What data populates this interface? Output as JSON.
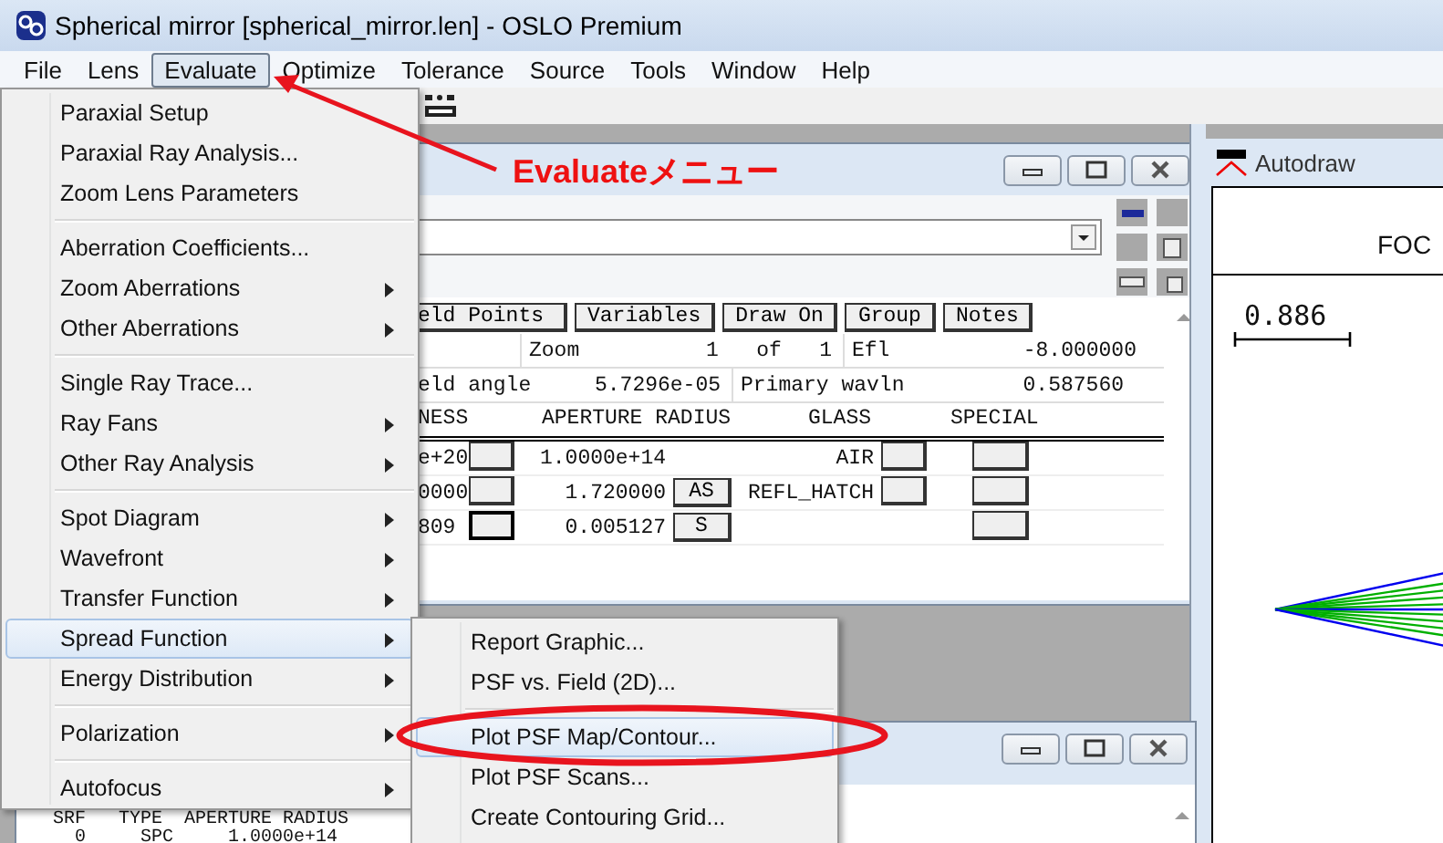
{
  "window": {
    "title": "Spherical mirror [spherical_mirror.len] - OSLO Premium"
  },
  "menu_bar": [
    {
      "label": "File",
      "selected": false
    },
    {
      "label": "Lens",
      "selected": false
    },
    {
      "label": "Evaluate",
      "selected": true
    },
    {
      "label": "Optimize",
      "selected": false
    },
    {
      "label": "Tolerance",
      "selected": false
    },
    {
      "label": "Source",
      "selected": false
    },
    {
      "label": "Tools",
      "selected": false
    },
    {
      "label": "Window",
      "selected": false
    },
    {
      "label": "Help",
      "selected": false
    }
  ],
  "lens_window": {
    "buttons": [
      "eld Points",
      "Variables",
      "Draw On",
      "Group",
      "Notes"
    ],
    "info_rows": [
      [
        {
          "label": "Zoom",
          "value": "1   of   1"
        },
        {
          "label": "Efl",
          "value": "-8.000000"
        }
      ],
      [
        {
          "label": "eld angle",
          "value": "5.7296e-05"
        },
        {
          "label": "Primary wavln",
          "value": "0.587560"
        }
      ]
    ],
    "columns": [
      "NESS",
      "APERTURE RADIUS",
      "GLASS",
      "SPECIAL"
    ],
    "rows": [
      {
        "thickness": "e+20",
        "focused": false,
        "aperture": "1.0000e+14",
        "glass": "AIR",
        "glass_button": true
      },
      {
        "thickness": "0000",
        "focused": false,
        "aperture": "1.720000",
        "solve": "AS",
        "glass": "REFL_HATCH",
        "glass_button": true
      },
      {
        "thickness": "809",
        "focused": true,
        "aperture": "0.005127",
        "solve": "S",
        "glass_button": false
      }
    ]
  },
  "autodraw": {
    "title": "Autodraw",
    "heading": "FOC",
    "scale": "0.886"
  },
  "text_window": {
    "lines": [
      "SRF   TYPE  APERTURE RADIUS",
      "  0     SPC     1.0000e+14"
    ]
  },
  "evaluate_menu": [
    {
      "kind": "item",
      "label": "Paraxial Setup",
      "submenu": false,
      "selected": false
    },
    {
      "kind": "item",
      "label": "Paraxial Ray Analysis...",
      "submenu": false,
      "selected": false
    },
    {
      "kind": "item",
      "label": "Zoom Lens Parameters",
      "submenu": false,
      "selected": false
    },
    {
      "kind": "separator"
    },
    {
      "kind": "item",
      "label": "Aberration Coefficients...",
      "submenu": false,
      "selected": false
    },
    {
      "kind": "item",
      "label": "Zoom Aberrations",
      "submenu": true,
      "selected": false
    },
    {
      "kind": "item",
      "label": "Other Aberrations",
      "submenu": true,
      "selected": false
    },
    {
      "kind": "separator"
    },
    {
      "kind": "item",
      "label": "Single Ray Trace...",
      "submenu": false,
      "selected": false
    },
    {
      "kind": "item",
      "label": "Ray Fans",
      "submenu": true,
      "selected": false
    },
    {
      "kind": "item",
      "label": "Other Ray Analysis",
      "submenu": true,
      "selected": false
    },
    {
      "kind": "separator"
    },
    {
      "kind": "item",
      "label": "Spot Diagram",
      "submenu": true,
      "selected": false
    },
    {
      "kind": "item",
      "label": "Wavefront",
      "submenu": true,
      "selected": false
    },
    {
      "kind": "item",
      "label": "Transfer Function",
      "submenu": true,
      "selected": false
    },
    {
      "kind": "item",
      "label": "Spread Function",
      "submenu": true,
      "selected": true
    },
    {
      "kind": "item",
      "label": "Energy Distribution",
      "submenu": true,
      "selected": false
    },
    {
      "kind": "separator"
    },
    {
      "kind": "item",
      "label": "Polarization",
      "submenu": true,
      "selected": false
    },
    {
      "kind": "separator"
    },
    {
      "kind": "item",
      "label": "Autofocus",
      "submenu": true,
      "selected": false
    }
  ],
  "spread_submenu": [
    {
      "kind": "item",
      "label": "Report Graphic...",
      "selected": false
    },
    {
      "kind": "item",
      "label": "PSF vs. Field (2D)...",
      "selected": false
    },
    {
      "kind": "separator"
    },
    {
      "kind": "item",
      "label": "Plot PSF Map/Contour...",
      "selected": true
    },
    {
      "kind": "item",
      "label": "Plot PSF Scans...",
      "selected": false
    },
    {
      "kind": "item",
      "label": "Create Contouring Grid...",
      "selected": false
    }
  ],
  "annotation": {
    "callout": "Evaluateメニュー"
  }
}
